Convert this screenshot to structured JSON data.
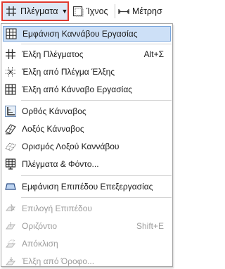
{
  "toolbar": {
    "grids_label": "Πλέγματα",
    "echo_label": "Ίχνος",
    "measure_label": "Μέτρησ"
  },
  "menu": {
    "items": [
      {
        "label": "Εμφάνιση Καννάβου Εργασίας",
        "shortcut": "",
        "icon": "work-grid-icon",
        "state": "highlighted"
      },
      {
        "label": "Έλξη Πλέγματος",
        "shortcut": "Alt+Σ",
        "icon": "snap-grid-icon",
        "state": "enabled"
      },
      {
        "label": "Έλξη από Πλέγμα Έλξης",
        "shortcut": "",
        "icon": "snap-dot-grid-icon",
        "state": "enabled"
      },
      {
        "label": "Έλξη από Κάνναβο Εργασίας",
        "shortcut": "",
        "icon": "snap-work-grid-icon",
        "state": "enabled"
      },
      {
        "label": "Ορθός Κάνναβος",
        "shortcut": "",
        "icon": "orthogonal-grid-icon",
        "state": "enabled"
      },
      {
        "label": "Λοξός Κάνναβος",
        "shortcut": "",
        "icon": "skewed-grid-icon",
        "state": "enabled"
      },
      {
        "label": "Ορισμός Λοξού Καννάβου",
        "shortcut": "",
        "icon": "define-skewed-grid-icon",
        "state": "enabled"
      },
      {
        "label": "Πλέγματα & Φόντο...",
        "shortcut": "",
        "icon": "grids-background-icon",
        "state": "enabled"
      },
      {
        "label": "Εμφάνιση Επιπέδου Επεξεργασίας",
        "shortcut": "",
        "icon": "editing-plane-icon",
        "state": "enabled"
      },
      {
        "label": "Επιλογή Επιπέδου",
        "shortcut": "",
        "icon": "select-plane-icon",
        "state": "disabled"
      },
      {
        "label": "Οριζόντιο",
        "shortcut": "Shift+E",
        "icon": "horizontal-plane-icon",
        "state": "disabled"
      },
      {
        "label": "Απόκλιση",
        "shortcut": "",
        "icon": "offset-plane-icon",
        "state": "disabled"
      },
      {
        "label": "Έλξη από Όροφο...",
        "shortcut": "",
        "icon": "snap-from-story-icon",
        "state": "disabled"
      }
    ]
  },
  "colors": {
    "highlight_bg": "#cde0f7",
    "highlight_border": "#7aa6dc",
    "toolbar_active_border": "#e03a2f",
    "disabled_text": "#9c9c9c"
  }
}
